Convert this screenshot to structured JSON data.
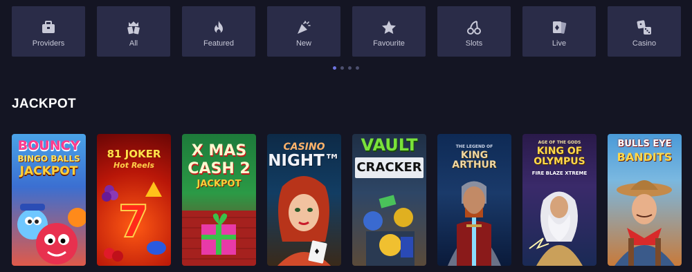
{
  "categories": [
    {
      "label": "Providers",
      "icon": "briefcase-icon"
    },
    {
      "label": "All",
      "icon": "crown-cards-icon"
    },
    {
      "label": "Featured",
      "icon": "fire-icon"
    },
    {
      "label": "New",
      "icon": "party-popper-icon"
    },
    {
      "label": "Favourite",
      "icon": "star-icon"
    },
    {
      "label": "Slots",
      "icon": "cherries-icon"
    },
    {
      "label": "Live",
      "icon": "playing-cards-icon"
    },
    {
      "label": "Casino",
      "icon": "dice-icon"
    }
  ],
  "pagination": {
    "count": 4,
    "active": 0
  },
  "section_title": "JACKPOT",
  "games": [
    {
      "line1": "BOUNCY",
      "line2": "BINGO BALLS",
      "line3": "JACKPOT"
    },
    {
      "line1": "81 JOKER",
      "line2": "Hot Reels",
      "line3": ""
    },
    {
      "line1": "X MAS",
      "line2": "CASH 2",
      "line3": "JACKPOT"
    },
    {
      "line1": "CASINO",
      "line2": "NIGHT™",
      "line3": ""
    },
    {
      "line1": "VAULT",
      "line2": "CRACKER",
      "line3": ""
    },
    {
      "line1": "THE LEGEND OF",
      "line2": "KING ARTHUR",
      "line3": ""
    },
    {
      "line1": "AGE OF THE GODS",
      "line2": "KING OF OLYMPUS",
      "line3": "FIRE BLAZE XTREME"
    },
    {
      "line1": "BULLS EYE",
      "line2": "BANDITS",
      "line3": ""
    }
  ],
  "colors": {
    "background": "#141523",
    "tile": "#2a2c48",
    "dot_active": "#6e74e0"
  }
}
